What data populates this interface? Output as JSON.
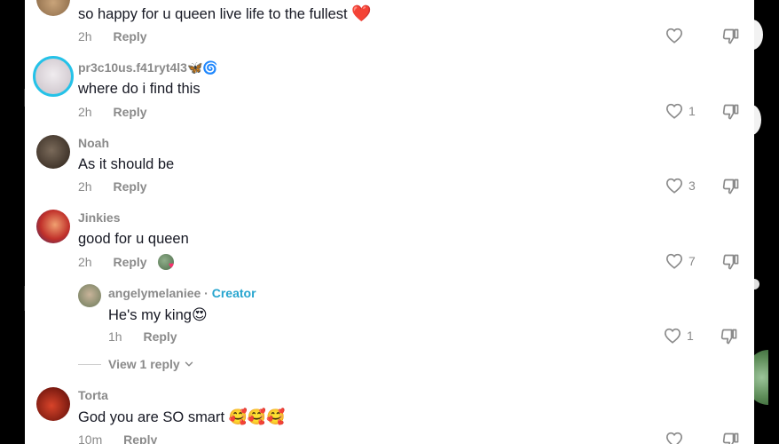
{
  "comments": [
    {
      "username": "",
      "text": "so happy for u queen live life to the fullest",
      "emoji": "❤️",
      "time": "2h",
      "reply": "Reply",
      "likes": ""
    },
    {
      "username": "pr3c10us.f41ryt4l3",
      "username_emoji": "🦋🌀",
      "text": "where do i find this",
      "time": "2h",
      "reply": "Reply",
      "likes": "1"
    },
    {
      "username": "Noah",
      "text": "As it should be",
      "time": "2h",
      "reply": "Reply",
      "likes": "3"
    },
    {
      "username": "Jinkies",
      "text": "good for u queen",
      "time": "2h",
      "reply": "Reply",
      "likes": "7"
    },
    {
      "username": "angelymelaniee",
      "separator": "·",
      "creator_badge": "Creator",
      "text": "He's my king",
      "emoji": "😍",
      "time": "1h",
      "reply": "Reply",
      "likes": "1"
    },
    {
      "username": "Torta",
      "text": "God you are SO smart",
      "emoji": "🥰🥰🥰",
      "time": "10m",
      "reply": "Reply",
      "likes": ""
    }
  ],
  "view_replies": {
    "label": "View 1 reply"
  },
  "icons": {
    "like": "heart-outline-icon",
    "dislike": "thumbs-down-icon",
    "expand": "chevron-down-icon"
  },
  "colors": {
    "creator": "#27a5cf",
    "muted": "#8a8a8a",
    "text": "#161823",
    "heart": "#e8273b"
  }
}
